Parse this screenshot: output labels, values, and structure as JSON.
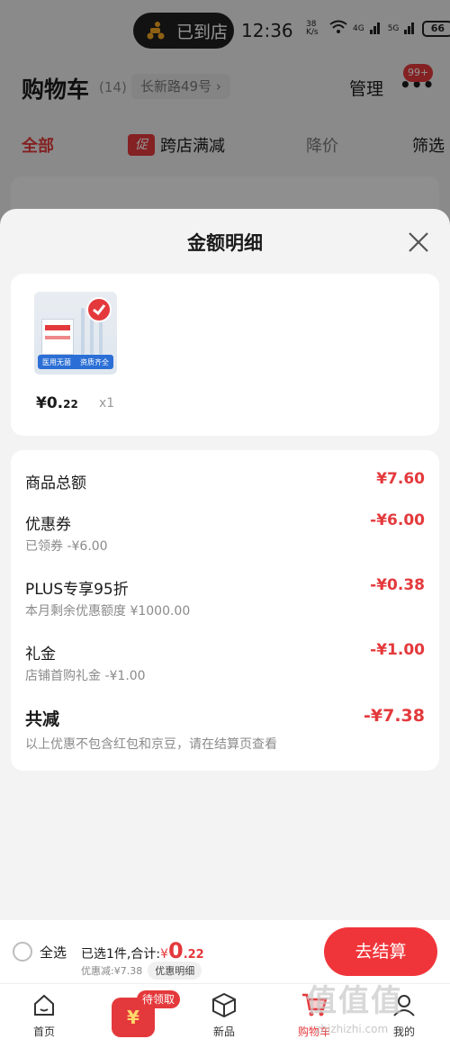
{
  "status_bar": {
    "arrived_label": "已到店",
    "time": "12:36",
    "net_speed": "38 K/s",
    "signal_1": "4G",
    "signal_2": "5G",
    "battery": "66"
  },
  "cart": {
    "title": "购物车",
    "count": "(14)",
    "address": "长新路49号 ›",
    "manage": "管理",
    "notification_badge": "99+",
    "tabs": [
      "全部",
      "跨店满减",
      "降价",
      "筛选"
    ],
    "cross_store_tag": "促"
  },
  "sheet": {
    "title": "金额明细",
    "product": {
      "price_int": "¥0.",
      "price_dec": "22",
      "qty": "x1",
      "thumb_banner": [
        "医用无菌",
        "资质齐全"
      ]
    },
    "rows": [
      {
        "label": "商品总额",
        "amount": "¥7.60",
        "sub": ""
      },
      {
        "label": "优惠券",
        "amount": "-¥6.00",
        "sub": "已领券 -¥6.00"
      },
      {
        "label": "PLUS专享95折",
        "amount": "-¥0.38",
        "sub": "本月剩余优惠额度 ¥1000.00"
      },
      {
        "label": "礼金",
        "amount": "-¥1.00",
        "sub": "店铺首购礼金 -¥1.00"
      },
      {
        "label": "共减",
        "amount": "-¥7.38",
        "sub": "以上优惠不包含红包和京豆，请在结算页查看"
      }
    ]
  },
  "checkout": {
    "select_all": "全选",
    "selected_text": "已选1件,合计:",
    "currency": "¥",
    "total_int": "0",
    "total_dec": ".22",
    "discount_text": "优惠减:¥7.38",
    "detail_chip": "优惠明细",
    "checkout_button": "去结算"
  },
  "tab_bar": {
    "items": [
      "首页",
      "新品",
      "购物车",
      "我的"
    ],
    "coupon_badge": "待领取",
    "coupon_symbol": "¥"
  },
  "watermark": {
    "text": "值值值",
    "url": "zhizhizhi.com"
  },
  "colors": {
    "accent": "#e4393c",
    "checkout_button": "#f0353a"
  }
}
